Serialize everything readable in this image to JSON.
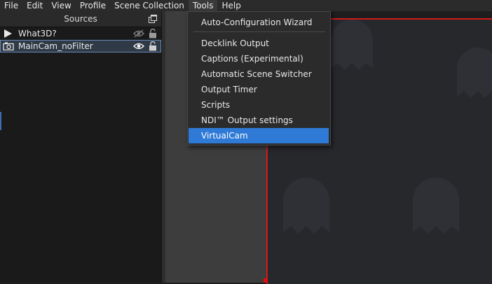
{
  "menubar": {
    "items": [
      {
        "label": "File"
      },
      {
        "label": "Edit"
      },
      {
        "label": "View"
      },
      {
        "label": "Profile"
      },
      {
        "label": "Scene Collection"
      },
      {
        "label": "Tools"
      },
      {
        "label": "Help"
      }
    ]
  },
  "sources": {
    "title": "Sources",
    "items": [
      {
        "label": "What3D?",
        "type_icon": "play-icon",
        "visibility_icon": "eye-hidden-icon",
        "lock_icon": "unlocked-icon"
      },
      {
        "label": "MainCam_noFilter",
        "type_icon": "camera-icon",
        "visibility_icon": "eye-icon",
        "lock_icon": "unlocked-icon",
        "selected": true
      }
    ]
  },
  "tools_menu": {
    "items": [
      {
        "label": "Auto-Configuration Wizard"
      },
      {
        "label": "Decklink Output"
      },
      {
        "label": "Captions (Experimental)"
      },
      {
        "label": "Automatic Scene Switcher"
      },
      {
        "label": "Output Timer"
      },
      {
        "label": "Scripts"
      },
      {
        "label": "NDI™ Output settings"
      },
      {
        "label": "VirtualCam",
        "highlighted": true
      }
    ]
  },
  "colors": {
    "highlight": "#2f7ad6",
    "preview_border": "#d11a1a",
    "panel_bg": "#1a1a1a",
    "selected_row": "#2f3a46"
  }
}
